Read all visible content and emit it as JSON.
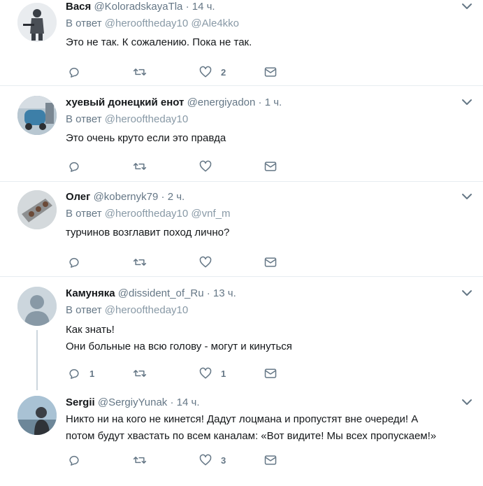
{
  "reply_prefix": "В ответ",
  "tweets": [
    {
      "name": "Вася",
      "handle": "@KoloradskayaTla",
      "time": "14 ч.",
      "reply_to": [
        "@herooftheday10",
        "@Ale4kko"
      ],
      "lines": [
        "Это не так. К сожалению. Пока не так."
      ],
      "replies": "",
      "retweets": "",
      "likes": "2"
    },
    {
      "name": "хуевый донецкий енот",
      "handle": "@energiyadon",
      "time": "1 ч.",
      "reply_to": [
        "@herooftheday10"
      ],
      "lines": [
        "Это очень круто если это правда"
      ],
      "replies": "",
      "retweets": "",
      "likes": ""
    },
    {
      "name": "Олег",
      "handle": "@kobernyk79",
      "time": "2 ч.",
      "reply_to": [
        "@herooftheday10",
        "@vnf_m"
      ],
      "lines": [
        "турчинов возглавит поход лично?"
      ],
      "replies": "",
      "retweets": "",
      "likes": ""
    },
    {
      "name": "Камуняка",
      "handle": "@dissident_of_Ru",
      "time": "13 ч.",
      "reply_to": [
        "@herooftheday10"
      ],
      "lines": [
        "Как знать!",
        "Они больные на всю голову - могут и кинуться"
      ],
      "replies": "1",
      "retweets": "",
      "likes": "1"
    },
    {
      "name": "Sergii",
      "handle": "@SergiyYunak",
      "time": "14 ч.",
      "reply_to": [],
      "lines": [
        "Никто ни на кого не кинется! Дадут лоцмана и пропустят вне очереди! А",
        "потом будут хвастать по всем каналам: «Вот видите! Мы всех пропускаем!»"
      ],
      "replies": "",
      "retweets": "",
      "likes": "3"
    }
  ],
  "colors": {
    "icon": "#657786",
    "reply_link": "#8899a6",
    "divider": "#e6ecf0",
    "thread": "#ccd6dd"
  },
  "icons": [
    "reply-icon",
    "retweet-icon",
    "like-icon",
    "message-icon",
    "chevron-down-icon"
  ]
}
